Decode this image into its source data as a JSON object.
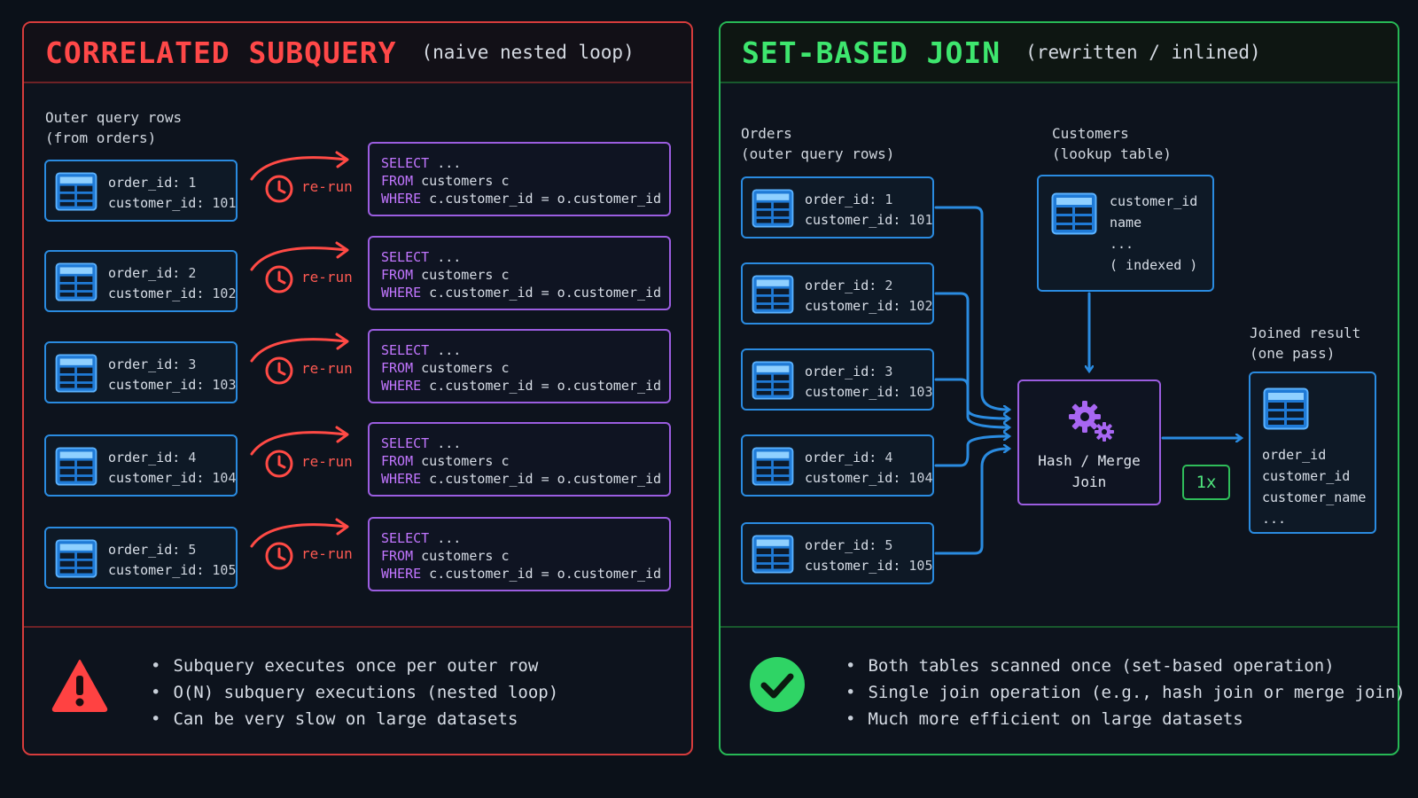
{
  "left": {
    "title": "CORRELATED SUBQUERY",
    "subtitle": "(naive nested loop)",
    "rows_label": "Outer query rows\n(from orders)",
    "rows": [
      {
        "order_key": "order_id:",
        "order_val": "1",
        "cust_key": "customer_id:",
        "cust_val": "101"
      },
      {
        "order_key": "order_id:",
        "order_val": "2",
        "cust_key": "customer_id:",
        "cust_val": "102"
      },
      {
        "order_key": "order_id:",
        "order_val": "3",
        "cust_key": "customer_id:",
        "cust_val": "103"
      },
      {
        "order_key": "order_id:",
        "order_val": "4",
        "cust_key": "customer_id:",
        "cust_val": "104"
      },
      {
        "order_key": "order_id:",
        "order_val": "5",
        "cust_key": "customer_id:",
        "cust_val": "105"
      }
    ],
    "rerun_label": "re-run",
    "sql": {
      "kw1": "SELECT",
      "rest1": " ...",
      "kw2": "FROM",
      "rest2": " customers c",
      "kw3": "WHERE",
      "rest3": " c.customer_id = o.customer_id"
    },
    "bullets": [
      "Subquery executes once per outer row",
      "O(N) subquery executions (nested loop)",
      "Can be very slow on large datasets"
    ],
    "footer_icon": "warning-icon"
  },
  "right": {
    "title": "SET-BASED JOIN",
    "subtitle": "(rewritten / inlined)",
    "orders_label": "Orders\n(outer query rows)",
    "customers_label": "Customers\n(lookup table)",
    "rows": [
      {
        "order_key": "order_id:",
        "order_val": "1",
        "cust_key": "customer_id:",
        "cust_val": "101"
      },
      {
        "order_key": "order_id:",
        "order_val": "2",
        "cust_key": "customer_id:",
        "cust_val": "102"
      },
      {
        "order_key": "order_id:",
        "order_val": "3",
        "cust_key": "customer_id:",
        "cust_val": "103"
      },
      {
        "order_key": "order_id:",
        "order_val": "4",
        "cust_key": "customer_id:",
        "cust_val": "104"
      },
      {
        "order_key": "order_id:",
        "order_val": "5",
        "cust_key": "customer_id:",
        "cust_val": "105"
      }
    ],
    "lookup_text": "customer_id\nname\n...\n( indexed )",
    "join_text": "Hash / Merge\nJoin",
    "join_count": "1x",
    "result_label": "Joined result\n(one pass)",
    "result_text": "order_id\ncustomer_id\ncustomer_name\n...",
    "bullets": [
      "Both tables scanned once (set-based operation)",
      "Single join operation (e.g., hash join or merge join)",
      "Much more efficient on large datasets"
    ],
    "footer_icon": "check-circle-icon"
  },
  "colors": {
    "left_accent": "#ff4848",
    "right_accent": "#3ee66e",
    "row_border": "#2a8be0",
    "sql_border": "#9b5de0",
    "keyword": "#c276ff"
  }
}
